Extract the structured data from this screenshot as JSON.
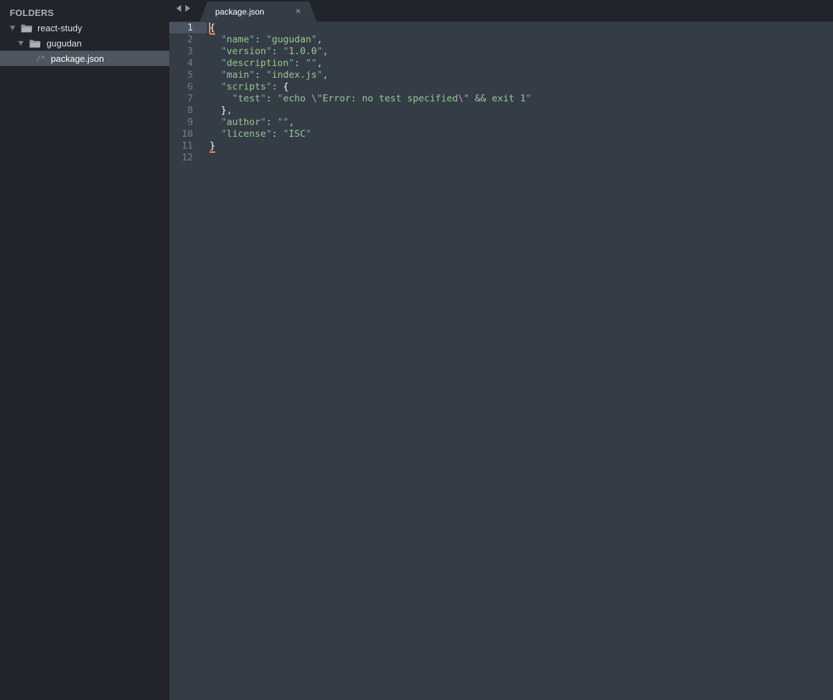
{
  "sidebar": {
    "header": "FOLDERS",
    "items": [
      {
        "label": "react-study",
        "type": "folder",
        "expanded": true
      },
      {
        "label": "gugudan",
        "type": "folder",
        "expanded": true
      },
      {
        "label": "package.json",
        "type": "file",
        "prefix": "/*",
        "selected": true
      }
    ]
  },
  "tabbar": {
    "active_tab": {
      "label": "package.json",
      "close": "×"
    }
  },
  "editor": {
    "line_numbers": [
      "1",
      "2",
      "3",
      "4",
      "5",
      "6",
      "7",
      "8",
      "9",
      "10",
      "11",
      "12"
    ],
    "lines": [
      [
        {
          "t": "brace",
          "v": "{"
        }
      ],
      [
        {
          "t": "q",
          "v": "  \""
        },
        {
          "t": "key",
          "v": "name"
        },
        {
          "t": "q",
          "v": "\""
        },
        {
          "t": "punc",
          "v": ": "
        },
        {
          "t": "q",
          "v": "\""
        },
        {
          "t": "str",
          "v": "gugudan"
        },
        {
          "t": "q",
          "v": "\""
        },
        {
          "t": "punc",
          "v": ","
        }
      ],
      [
        {
          "t": "q",
          "v": "  \""
        },
        {
          "t": "key",
          "v": "version"
        },
        {
          "t": "q",
          "v": "\""
        },
        {
          "t": "punc",
          "v": ": "
        },
        {
          "t": "q",
          "v": "\""
        },
        {
          "t": "str",
          "v": "1.0.0"
        },
        {
          "t": "q",
          "v": "\""
        },
        {
          "t": "punc",
          "v": ","
        }
      ],
      [
        {
          "t": "q",
          "v": "  \""
        },
        {
          "t": "key",
          "v": "description"
        },
        {
          "t": "q",
          "v": "\""
        },
        {
          "t": "punc",
          "v": ": "
        },
        {
          "t": "q",
          "v": "\"\""
        },
        {
          "t": "punc",
          "v": ","
        }
      ],
      [
        {
          "t": "q",
          "v": "  \""
        },
        {
          "t": "key",
          "v": "main"
        },
        {
          "t": "q",
          "v": "\""
        },
        {
          "t": "punc",
          "v": ": "
        },
        {
          "t": "q",
          "v": "\""
        },
        {
          "t": "str",
          "v": "index.js"
        },
        {
          "t": "q",
          "v": "\""
        },
        {
          "t": "punc",
          "v": ","
        }
      ],
      [
        {
          "t": "q",
          "v": "  \""
        },
        {
          "t": "key",
          "v": "scripts"
        },
        {
          "t": "q",
          "v": "\""
        },
        {
          "t": "punc",
          "v": ": "
        },
        {
          "t": "brace",
          "v": "{"
        }
      ],
      [
        {
          "t": "q",
          "v": "    \""
        },
        {
          "t": "key",
          "v": "test"
        },
        {
          "t": "q",
          "v": "\""
        },
        {
          "t": "punc",
          "v": ": "
        },
        {
          "t": "q",
          "v": "\""
        },
        {
          "t": "str",
          "v": "echo "
        },
        {
          "t": "esc",
          "v": "\\\""
        },
        {
          "t": "str",
          "v": "Error: no test specified"
        },
        {
          "t": "esc",
          "v": "\\\""
        },
        {
          "t": "str",
          "v": " && exit 1"
        },
        {
          "t": "q",
          "v": "\""
        }
      ],
      [
        {
          "t": "brace",
          "v": "  }"
        },
        {
          "t": "punc",
          "v": ","
        }
      ],
      [
        {
          "t": "q",
          "v": "  \""
        },
        {
          "t": "key",
          "v": "author"
        },
        {
          "t": "q",
          "v": "\""
        },
        {
          "t": "punc",
          "v": ": "
        },
        {
          "t": "q",
          "v": "\"\""
        },
        {
          "t": "punc",
          "v": ","
        }
      ],
      [
        {
          "t": "q",
          "v": "  \""
        },
        {
          "t": "key",
          "v": "license"
        },
        {
          "t": "q",
          "v": "\""
        },
        {
          "t": "punc",
          "v": ": "
        },
        {
          "t": "q",
          "v": "\""
        },
        {
          "t": "str",
          "v": "ISC"
        },
        {
          "t": "q",
          "v": "\""
        }
      ],
      [
        {
          "t": "brace",
          "v": "}"
        }
      ],
      []
    ]
  },
  "colors": {
    "background": "#343d46",
    "sidebar": "#21252b",
    "string": "#99c794",
    "quote": "#5fb3b3",
    "escape": "#c594c5",
    "caret": "#f99157"
  }
}
